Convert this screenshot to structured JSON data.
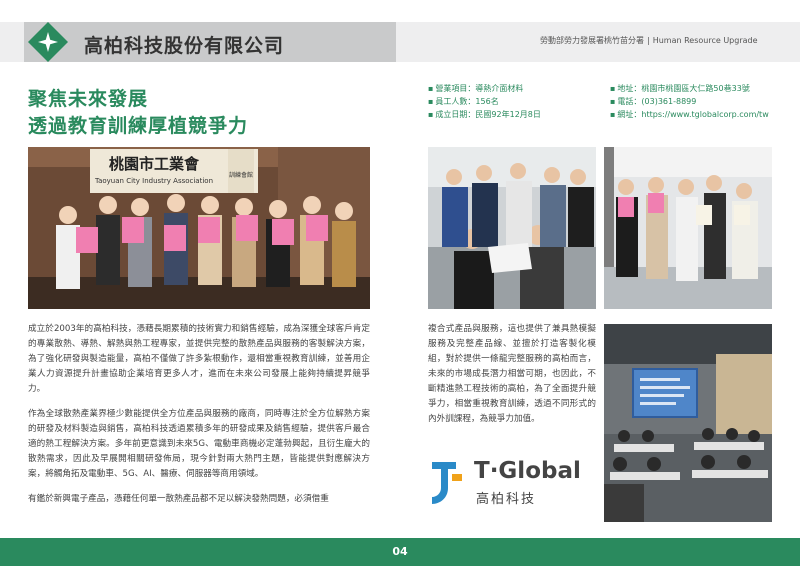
{
  "header": {
    "company_name": "高柏科技股份有限公司",
    "program": "勞動部勞力發展署桃竹苗分署",
    "separator": "|",
    "program_en": "Human Resource Upgrade",
    "logo_icon": "diamond-star-icon",
    "accent_color": "#2a8a5e"
  },
  "headline": {
    "line1": "聚焦未來發展",
    "line2": "透過教育訓練厚植競爭力"
  },
  "info_left": [
    "營業項目：導熱介面材料",
    "員工人數：156名",
    "成立日期：民國92年12月8日"
  ],
  "info_right": [
    "地址：桃園市桃園區大仁路50巷33號",
    "電話：(03)361-8899",
    "網址：https://www.tglobalcorp.com/tw"
  ],
  "photos": {
    "main_sign_line1": "桃園市工業會",
    "main_sign_line2": "Taoyuan City Industry Association",
    "main_sign_side": "訓練會館"
  },
  "body_left": [
    "成立於2003年的高柏科技，憑藉長期累積的技術實力和銷售經驗，成為深獲全球客戶肯定的專業散熱、導熱、解熱與熱工程專家，並提供完整的散熱產品與服務的客製解決方案，為了強化研發與製造能量，高柏不僅做了許多紮根動作，還相當重視教育訓練，並善用企業人力資源提升計畫協助企業培育更多人才，進而在未來公司發展上能夠持續提昇競爭力。",
    "作為全球散熱產業界極少數能提供全方位產品與服務的廠商，同時專注於全方位解熱方案的研發及材料製造與銷售，高柏科技透過累積多年的研發成果及銷售經驗，提供客戶最合適的熱工程解決方案。多年前更意識到未來5G、電動車商機必定蓬勃興起，且衍生龐大的散熱需求，因此及早展開相關研發佈局，現今針對兩大熱門主題，皆能提供對應解決方案，將觸角拓及電動車、5G、AI、醫療、伺服器等商用領域。",
    "有鑑於新興電子產品，憑藉任何單一散熱產品都不足以解決發熱問題，必須借重"
  ],
  "body_right": [
    "複合式產品與服務，這也提供了兼具熱模擬服務及完整產品線、並擅於打造客製化模組，對於提供一條龍完整服務的高柏而言，未來的市場成長潛力相當可期，也因此，不斷精進熱工程技術的高柏，為了全面提升競爭力，相當重視教育訓練，透過不同形式的內外訓課程，為競爭力加值。"
  ],
  "brand": {
    "icon": "t-global-logo-icon",
    "name": "T·Global",
    "subname": "高柏科技"
  },
  "footer": {
    "page_number": "04"
  }
}
